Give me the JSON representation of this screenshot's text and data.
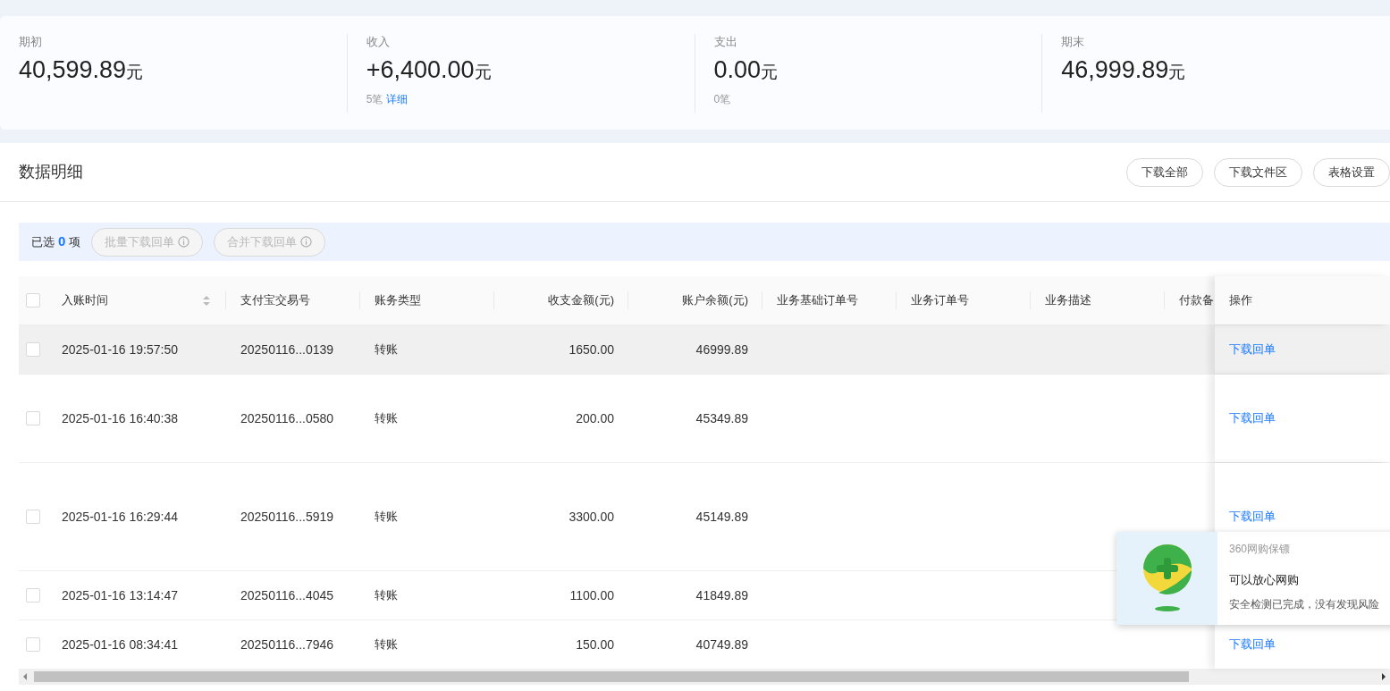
{
  "summary": [
    {
      "label": "期初",
      "amount": "40,599.89",
      "unit": "元"
    },
    {
      "label": "收入",
      "amount": "+6,400.00",
      "unit": "元",
      "count": "5笔",
      "link": "详细"
    },
    {
      "label": "支出",
      "amount": "0.00",
      "unit": "元",
      "count": "0笔"
    },
    {
      "label": "期末",
      "amount": "46,999.89",
      "unit": "元"
    }
  ],
  "section": {
    "title": "数据明细",
    "buttons": [
      "下载全部",
      "下载文件区",
      "表格设置"
    ]
  },
  "selection_bar": {
    "prefix": "已选",
    "count": "0",
    "suffix": "项",
    "buttons": [
      {
        "label": "批量下载回单",
        "disabled": true
      },
      {
        "label": "合并下载回单",
        "disabled": true
      }
    ]
  },
  "table": {
    "select_all": {
      "checked": false
    },
    "columns": [
      {
        "label": "入账时间",
        "sortable": true
      },
      {
        "label": "支付宝交易号",
        "sortable": false
      },
      {
        "label": "账务类型",
        "sortable": false
      },
      {
        "label": "收支金额(元)",
        "sortable": false
      },
      {
        "label": "账户余额(元)",
        "sortable": false
      },
      {
        "label": "业务基础订单号",
        "sortable": false
      },
      {
        "label": "业务订单号",
        "sortable": false
      },
      {
        "label": "业务描述",
        "sortable": false
      },
      {
        "label": "付款备"
      },
      {
        "label": "操作",
        "sortable": false
      }
    ],
    "rows": [
      {
        "checked": false,
        "hovered": true,
        "time": "2025-01-16 19:57:50",
        "trade_no": "20250116...0139",
        "type": "转账",
        "amount": "1650.00",
        "balance": "46999.89",
        "action": "下载回单"
      },
      {
        "checked": false,
        "hovered": false,
        "time": "2025-01-16 16:40:38",
        "trade_no": "20250116...0580",
        "type": "转账",
        "amount": "200.00",
        "balance": "45349.89",
        "action": "下载回单"
      },
      {
        "checked": false,
        "hovered": false,
        "time": "2025-01-16 16:29:44",
        "trade_no": "20250116...5919",
        "type": "转账",
        "amount": "3300.00",
        "balance": "45149.89",
        "action": "下载回单"
      },
      {
        "checked": false,
        "hovered": false,
        "time": "2025-01-16 13:14:47",
        "trade_no": "20250116...4045",
        "type": "转账",
        "amount": "1100.00",
        "balance": "41849.89"
      },
      {
        "checked": false,
        "hovered": false,
        "time": "2025-01-16 08:34:41",
        "trade_no": "20250116...7946",
        "type": "转账",
        "amount": "150.00",
        "balance": "40749.89",
        "action": "下载回单"
      }
    ]
  },
  "popup": {
    "source": "360网购保镖",
    "title": "可以放心网购",
    "message": "安全检测已完成，没有发现风险"
  }
}
